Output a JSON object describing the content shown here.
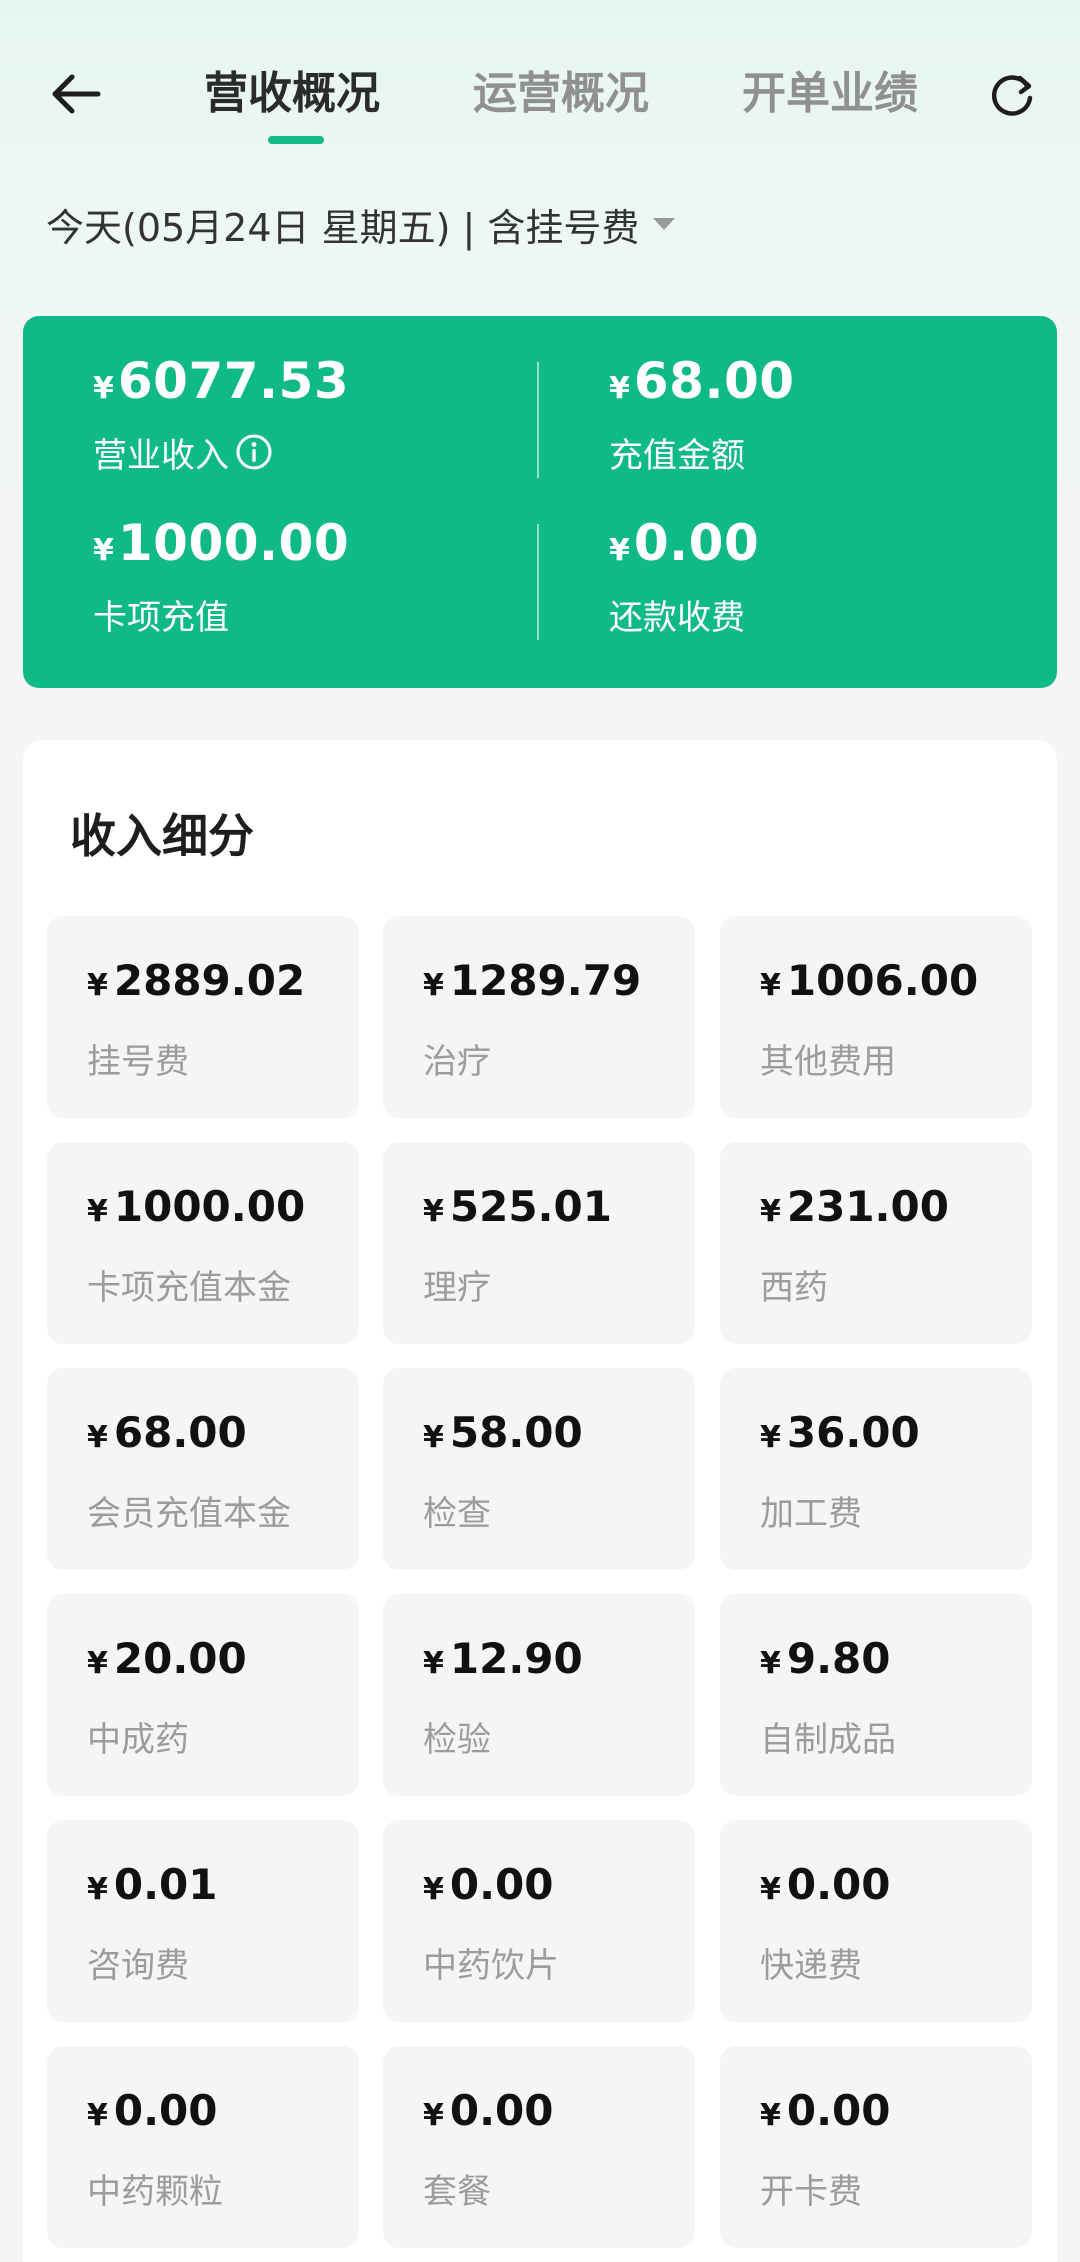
{
  "header": {
    "tabs": [
      {
        "label": "营收概况",
        "active": true
      },
      {
        "label": "运营概况",
        "active": false
      },
      {
        "label": "开单业绩",
        "active": false
      }
    ]
  },
  "filter": {
    "date_label": "今天(05月24日 星期五) | 含挂号费"
  },
  "summary": {
    "currency": "¥",
    "items": [
      {
        "value": "6077.53",
        "label": "营业收入",
        "has_info": true
      },
      {
        "value": "68.00",
        "label": "充值金额"
      },
      {
        "value": "1000.00",
        "label": "卡项充值"
      },
      {
        "value": "0.00",
        "label": "还款收费"
      }
    ]
  },
  "breakdown": {
    "title": "收入细分",
    "currency": "¥",
    "items": [
      {
        "value": "2889.02",
        "label": "挂号费"
      },
      {
        "value": "1289.79",
        "label": "治疗"
      },
      {
        "value": "1006.00",
        "label": "其他费用"
      },
      {
        "value": "1000.00",
        "label": "卡项充值本金"
      },
      {
        "value": "525.01",
        "label": "理疗"
      },
      {
        "value": "231.00",
        "label": "西药"
      },
      {
        "value": "68.00",
        "label": "会员充值本金"
      },
      {
        "value": "58.00",
        "label": "检查"
      },
      {
        "value": "36.00",
        "label": "加工费"
      },
      {
        "value": "20.00",
        "label": "中成药"
      },
      {
        "value": "12.90",
        "label": "检验"
      },
      {
        "value": "9.80",
        "label": "自制成品"
      },
      {
        "value": "0.01",
        "label": "咨询费"
      },
      {
        "value": "0.00",
        "label": "中药饮片"
      },
      {
        "value": "0.00",
        "label": "快递费"
      },
      {
        "value": "0.00",
        "label": "中药颗粒"
      },
      {
        "value": "0.00",
        "label": "套餐"
      },
      {
        "value": "0.00",
        "label": "开卡费"
      }
    ]
  },
  "colors": {
    "accent": "#10ba86",
    "tab_indicator": "#12ba86"
  },
  "icons": {
    "back": "back-arrow-icon",
    "refresh": "refresh-icon",
    "info": "info-icon",
    "dropdown": "caret-down-icon"
  }
}
